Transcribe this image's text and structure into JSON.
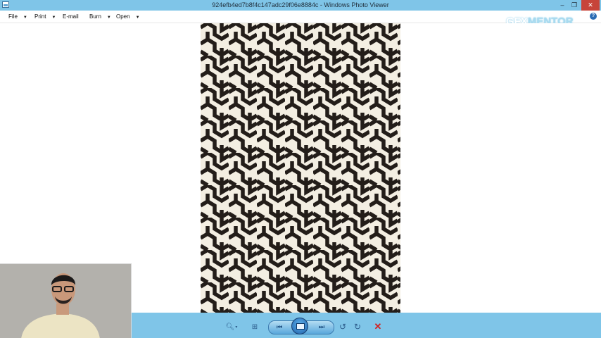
{
  "window": {
    "title": "924efb4ed7b8f4c147adc29f06e8884c - Windows Photo Viewer",
    "minimize_label": "–",
    "restore_label": "❐",
    "close_label": "✕"
  },
  "menu": {
    "items": [
      {
        "label": "File",
        "has_dropdown": true
      },
      {
        "label": "Print",
        "has_dropdown": true
      },
      {
        "label": "E-mail",
        "has_dropdown": false
      },
      {
        "label": "Burn",
        "has_dropdown": true
      },
      {
        "label": "Open",
        "has_dropdown": true
      }
    ],
    "help_label": "?"
  },
  "watermark": {
    "part1": "GFX",
    "part2": "MENTOR"
  },
  "photo": {
    "description_icon": "black-cream-hexagon-maze-pattern",
    "colors": {
      "ink": "#231d19",
      "paper": "#f3eee2"
    }
  },
  "toolbar": {
    "zoom_icon": "magnifier-icon",
    "actual_size_icon": "fit-window-icon",
    "previous_icon": "previous-icon",
    "slideshow_icon": "slideshow-icon",
    "next_icon": "next-icon",
    "rotate_ccw_icon": "rotate-counterclockwise-icon",
    "rotate_cw_icon": "rotate-clockwise-icon",
    "delete_icon": "delete-icon"
  },
  "colors": {
    "chrome": "#7fc5e8",
    "close": "#c7443a",
    "delete": "#d21f1f"
  }
}
